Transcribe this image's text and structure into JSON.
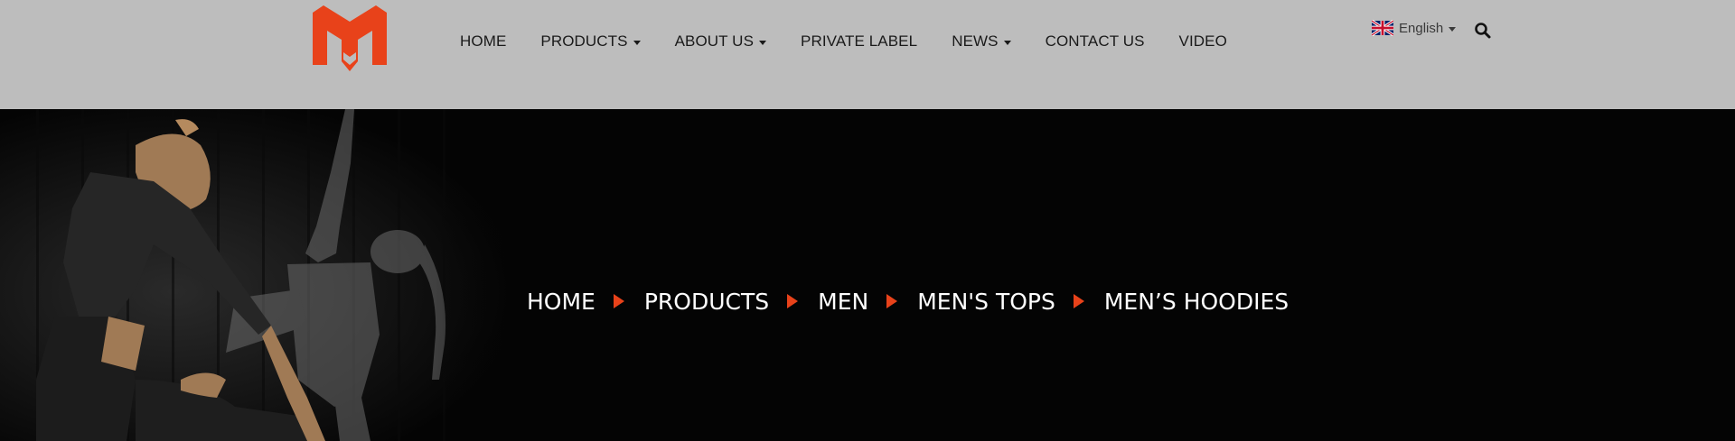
{
  "colors": {
    "header_bg": "#bdbdbd",
    "brand_orange": "#e8421a",
    "hero_bg": "#040404",
    "nav_text": "#1a1a1a",
    "breadcrumb_text": "#ffffff"
  },
  "header": {
    "logo_icon": "m-brand-logo-icon",
    "nav": [
      {
        "label": "HOME",
        "has_dropdown": false
      },
      {
        "label": "PRODUCTS",
        "has_dropdown": true
      },
      {
        "label": "ABOUT US",
        "has_dropdown": true
      },
      {
        "label": "PRIVATE LABEL",
        "has_dropdown": false
      },
      {
        "label": "NEWS",
        "has_dropdown": true
      },
      {
        "label": "CONTACT US",
        "has_dropdown": false
      },
      {
        "label": "VIDEO",
        "has_dropdown": false
      }
    ],
    "language": {
      "label": "English",
      "icon": "uk-flag-icon"
    },
    "search_icon": "search-icon"
  },
  "hero": {
    "breadcrumb": [
      "HOME",
      "PRODUCTS",
      "MEN",
      "MEN'S TOPS",
      "MEN’S HOODIES"
    ]
  }
}
